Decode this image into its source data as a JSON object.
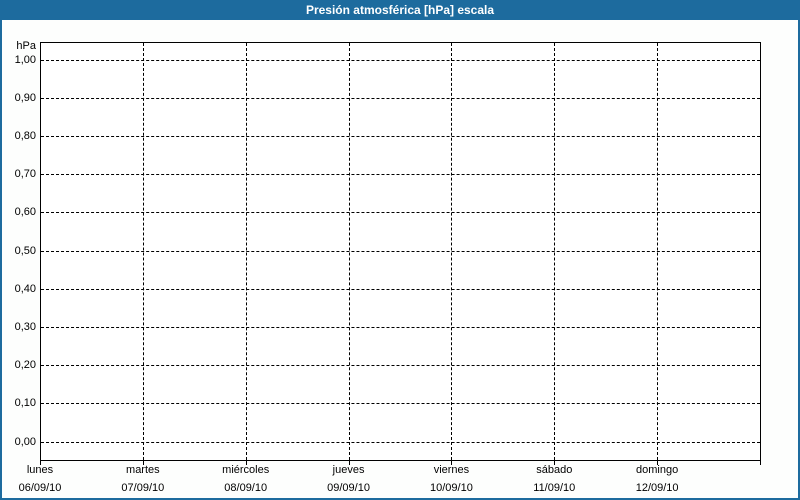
{
  "window": {
    "title": "Presión atmosférica [hPa] escala"
  },
  "colors": {
    "header_bg": "#1d6b9e",
    "frame_border": "#1d6b9e",
    "title_text": "#ffffff",
    "grid_line": "#000000",
    "axis_text": "#000000",
    "plot_bg": "#ffffff"
  },
  "chart_data": {
    "type": "line",
    "title": "Presión atmosférica [hPa] escala",
    "ylabel": "hPa",
    "xlabel": "",
    "ylim": [
      0.0,
      1.0
    ],
    "grid": "dashed",
    "legend_position": "none",
    "y_ticks": [
      {
        "label": "1,00",
        "value": 1.0
      },
      {
        "label": "0,90",
        "value": 0.9
      },
      {
        "label": "0,80",
        "value": 0.8
      },
      {
        "label": "0,70",
        "value": 0.7
      },
      {
        "label": "0,60",
        "value": 0.6
      },
      {
        "label": "0,50",
        "value": 0.5
      },
      {
        "label": "0,40",
        "value": 0.4
      },
      {
        "label": "0,30",
        "value": 0.3
      },
      {
        "label": "0,20",
        "value": 0.2
      },
      {
        "label": "0,10",
        "value": 0.1
      },
      {
        "label": "0,00",
        "value": 0.0
      }
    ],
    "categories": [
      {
        "day": "lunes",
        "date": "06/09/10"
      },
      {
        "day": "martes",
        "date": "07/09/10"
      },
      {
        "day": "miércoles",
        "date": "08/09/10"
      },
      {
        "day": "jueves",
        "date": "09/09/10"
      },
      {
        "day": "viernes",
        "date": "10/09/10"
      },
      {
        "day": "sábado",
        "date": "11/09/10"
      },
      {
        "day": "domingo",
        "date": "12/09/10"
      }
    ],
    "series": []
  }
}
